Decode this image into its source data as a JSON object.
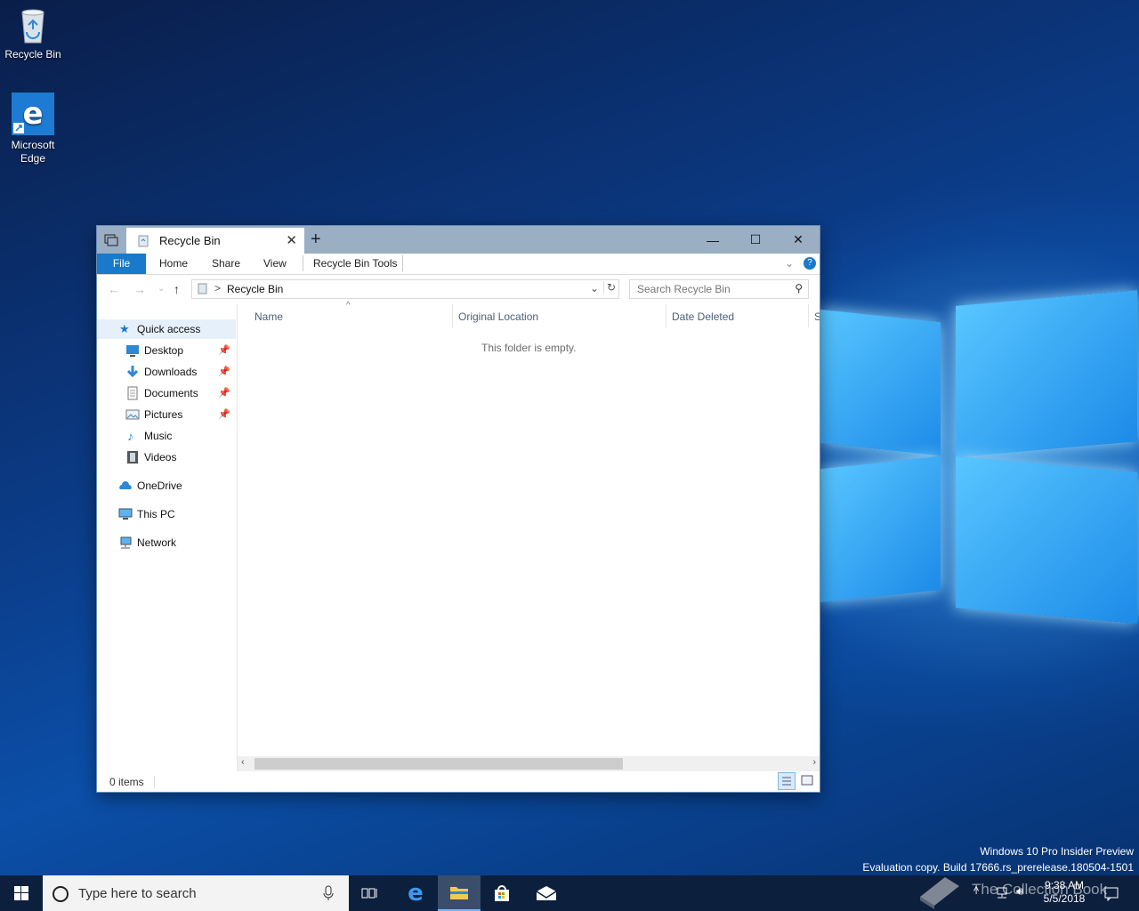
{
  "desktop": {
    "icons": [
      {
        "label": "Recycle Bin"
      },
      {
        "label": "Microsoft Edge"
      }
    ],
    "watermark": {
      "line1": "Windows 10 Pro Insider Preview",
      "line2": "Evaluation copy. Build 17666.rs_prerelease.180504-1501"
    },
    "overlay_logo_text": "The Collection Book"
  },
  "window": {
    "tab_title": "Recycle Bin",
    "controls": {
      "minimize": "—",
      "maximize": "☐",
      "close": "✕",
      "new_tab": "+"
    },
    "ribbon": {
      "file": "File",
      "home": "Home",
      "share": "Share",
      "view": "View",
      "tools": "Recycle Bin Tools"
    },
    "address": {
      "crumb_sep": ">",
      "crumb": "Recycle Bin"
    },
    "search": {
      "placeholder": "Search Recycle Bin"
    },
    "nav": {
      "quick_access": "Quick access",
      "items": [
        {
          "label": "Desktop",
          "pinned": true
        },
        {
          "label": "Downloads",
          "pinned": true
        },
        {
          "label": "Documents",
          "pinned": true
        },
        {
          "label": "Pictures",
          "pinned": true
        },
        {
          "label": "Music",
          "pinned": false
        },
        {
          "label": "Videos",
          "pinned": false
        }
      ],
      "onedrive": "OneDrive",
      "this_pc": "This PC",
      "network": "Network"
    },
    "columns": [
      "Name",
      "Original Location",
      "Date Deleted",
      "S"
    ],
    "empty_message": "This folder is empty.",
    "status": {
      "count": "0 items"
    }
  },
  "taskbar": {
    "search_placeholder": "Type here to search",
    "clock": {
      "time": "9:38 AM",
      "date": "5/5/2018"
    }
  },
  "colors": {
    "accent": "#1979ca",
    "titlebar": "#9aaec4",
    "taskbar": "#0c1f3d"
  }
}
